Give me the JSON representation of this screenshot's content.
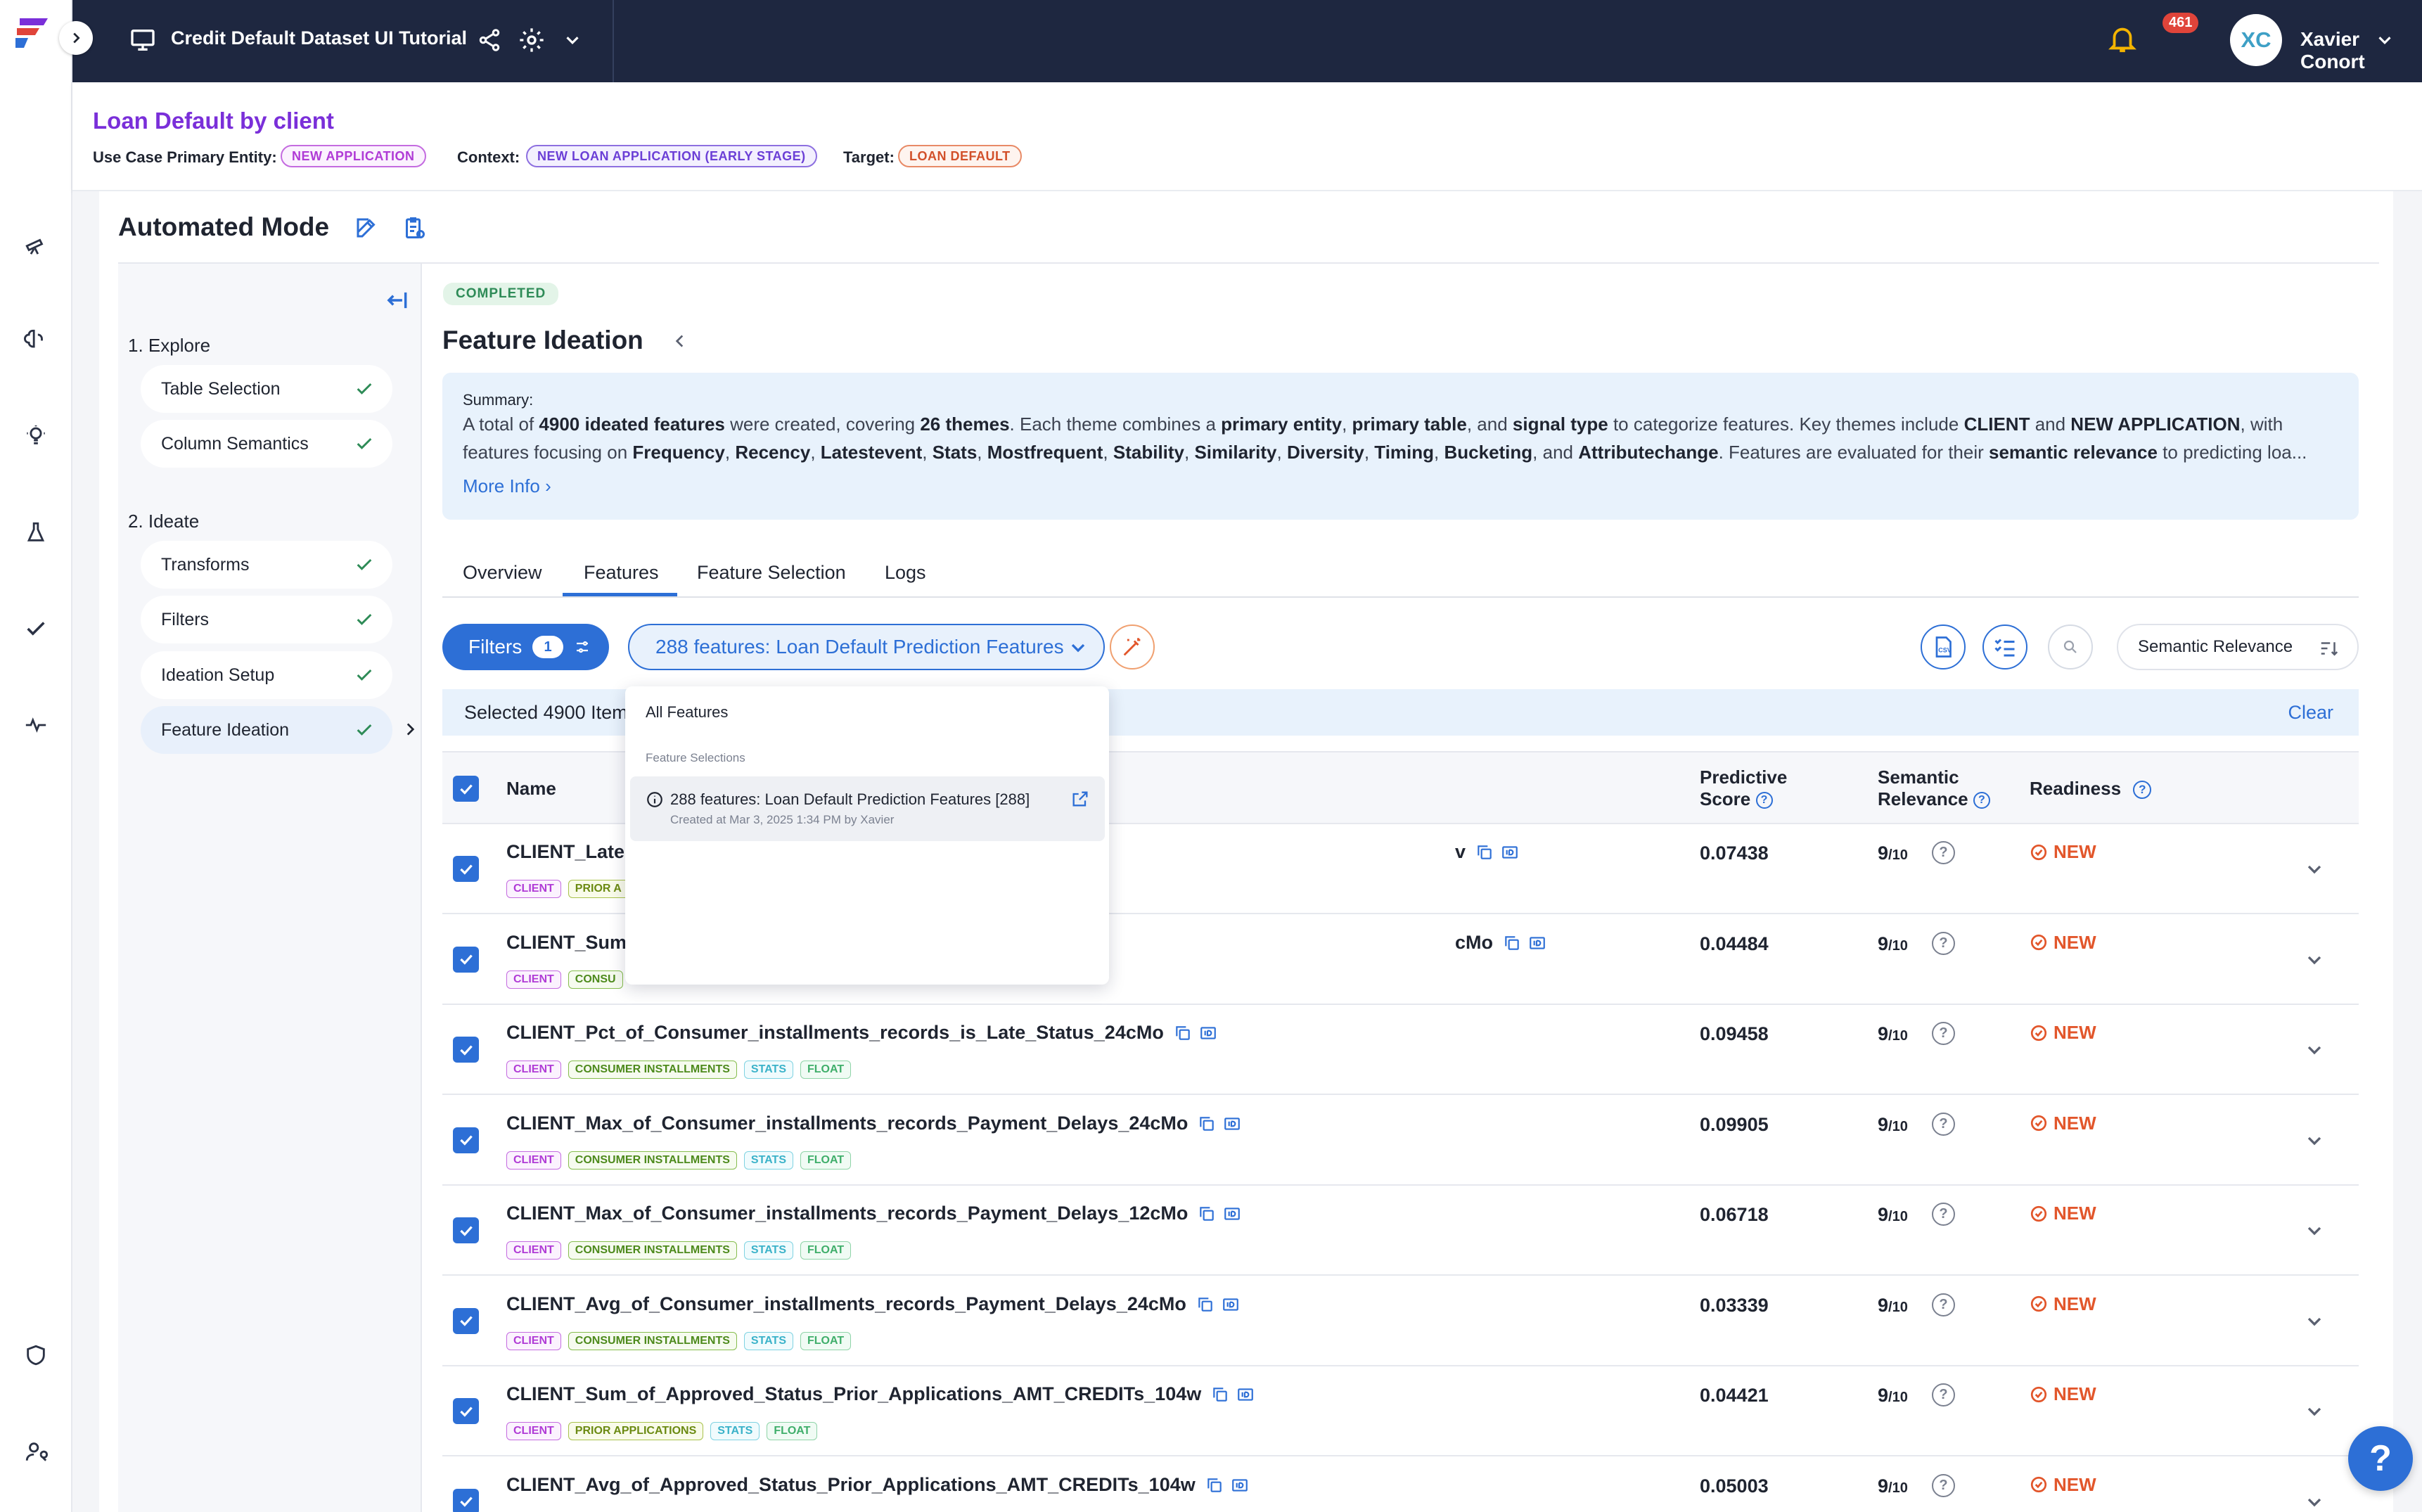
{
  "topbar": {
    "title": "Credit Default Dataset UI Tutorial",
    "notifications": "461",
    "avatar_initials": "XC",
    "user_name": "Xavier Conort"
  },
  "header": {
    "use_case_title": "Loan Default by client",
    "primary_entity_label": "Use Case Primary Entity:",
    "primary_entity": "NEW APPLICATION",
    "context_label": "Context:",
    "context": "NEW LOAN APPLICATION (EARLY STAGE)",
    "target_label": "Target:",
    "target": "LOAN DEFAULT"
  },
  "mode_title": "Automated Mode",
  "stepper": {
    "explore_heading": "1. Explore",
    "explore_steps": [
      "Table Selection",
      "Column Semantics"
    ],
    "ideate_heading": "2. Ideate",
    "ideate_steps": [
      "Transforms",
      "Filters",
      "Ideation Setup",
      "Feature Ideation"
    ]
  },
  "main": {
    "status": "COMPLETED",
    "title": "Feature Ideation",
    "summary_label": "Summary:",
    "more_info": "More Info",
    "tabs": [
      "Overview",
      "Features",
      "Feature Selection",
      "Logs"
    ],
    "active_tab": "Features"
  },
  "toolbar": {
    "filters_label": "Filters",
    "filters_count": "1",
    "selection_label": "288 features: Loan Default Prediction Features",
    "sort_label": "Semantic Relevance"
  },
  "banner": {
    "selected_text": "Selected 4900 Item",
    "clear": "Clear"
  },
  "dropdown": {
    "all": "All Features",
    "section": "Feature Selections",
    "item_title": "288 features: Loan Default Prediction Features [288]",
    "item_sub": "Created at Mar 3, 2025 1:34 PM by Xavier"
  },
  "table": {
    "headers": {
      "name": "Name",
      "predictive_1": "Predictive",
      "predictive_2": "Score",
      "semantic_1": "Semantic",
      "semantic_2": "Relevance",
      "readiness": "Readiness"
    },
    "rows": [
      {
        "name": "CLIENT_Lates",
        "tail": "v",
        "tags": [
          "CLIENT",
          "PRIOR A"
        ],
        "score": "0.07438",
        "sem": "9",
        "ready": "NEW"
      },
      {
        "name": "CLIENT_Sum_",
        "tail": "cMo",
        "tags": [
          "CLIENT",
          "CONSU"
        ],
        "score": "0.04484",
        "sem": "9",
        "ready": "NEW"
      },
      {
        "name": "CLIENT_Pct_of_Consumer_installments_records_is_Late_Status_24cMo",
        "tags": [
          "CLIENT",
          "CONSUMER INSTALLMENTS",
          "STATS",
          "FLOAT"
        ],
        "score": "0.09458",
        "sem": "9",
        "ready": "NEW"
      },
      {
        "name": "CLIENT_Max_of_Consumer_installments_records_Payment_Delays_24cMo",
        "tags": [
          "CLIENT",
          "CONSUMER INSTALLMENTS",
          "STATS",
          "FLOAT"
        ],
        "score": "0.09905",
        "sem": "9",
        "ready": "NEW"
      },
      {
        "name": "CLIENT_Max_of_Consumer_installments_records_Payment_Delays_12cMo",
        "tags": [
          "CLIENT",
          "CONSUMER INSTALLMENTS",
          "STATS",
          "FLOAT"
        ],
        "score": "0.06718",
        "sem": "9",
        "ready": "NEW"
      },
      {
        "name": "CLIENT_Avg_of_Consumer_installments_records_Payment_Delays_24cMo",
        "tags": [
          "CLIENT",
          "CONSUMER INSTALLMENTS",
          "STATS",
          "FLOAT"
        ],
        "score": "0.03339",
        "sem": "9",
        "ready": "NEW"
      },
      {
        "name": "CLIENT_Sum_of_Approved_Status_Prior_Applications_AMT_CREDITs_104w",
        "tags": [
          "CLIENT",
          "PRIOR APPLICATIONS",
          "STATS",
          "FLOAT"
        ],
        "score": "0.04421",
        "sem": "9",
        "ready": "NEW"
      },
      {
        "name": "CLIENT_Avg_of_Approved_Status_Prior_Applications_AMT_CREDITs_104w",
        "tags": [],
        "score": "0.05003",
        "sem": "9",
        "ready": "NEW"
      }
    ],
    "sem_denominator": "/10"
  },
  "colors": {
    "topbar": "#1e2740",
    "accent": "#2d6fd6",
    "brand_purple": "#7a2fd9",
    "ready_orange": "#e2562b"
  }
}
